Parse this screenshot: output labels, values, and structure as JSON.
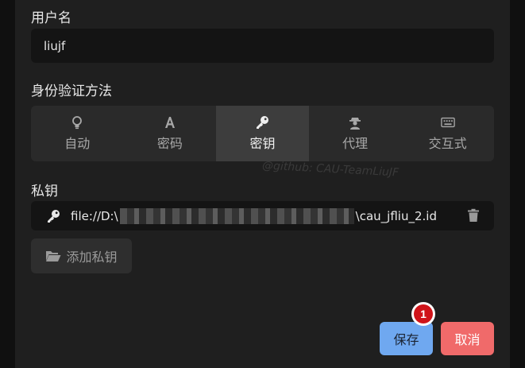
{
  "form": {
    "username_label": "用户名",
    "username_value": "liujf",
    "auth_label": "身份验证方法",
    "auth_methods": [
      {
        "label": "自动",
        "icon": "lightbulb-icon",
        "active": false
      },
      {
        "label": "密码",
        "icon": "text-a-icon",
        "active": false
      },
      {
        "label": "密钥",
        "icon": "key-icon",
        "active": true
      },
      {
        "label": "代理",
        "icon": "agent-icon",
        "active": false
      },
      {
        "label": "交互式",
        "icon": "keyboard-icon",
        "active": false
      }
    ],
    "private_key_label": "私钥",
    "key_path_prefix": "file://D:\\",
    "key_path_suffix": "\\cau_jfliu_2.id",
    "add_key_label": "添加私钥",
    "watermark": "@github: CAU-TeamLiuJF"
  },
  "actions": {
    "save_label": "保存",
    "cancel_label": "取消",
    "step_badge": "1"
  },
  "colors": {
    "save": "#6fa8f0",
    "cancel": "#f06a6a",
    "badge": "#d0141a",
    "active_segment": "#3d3d3d"
  }
}
